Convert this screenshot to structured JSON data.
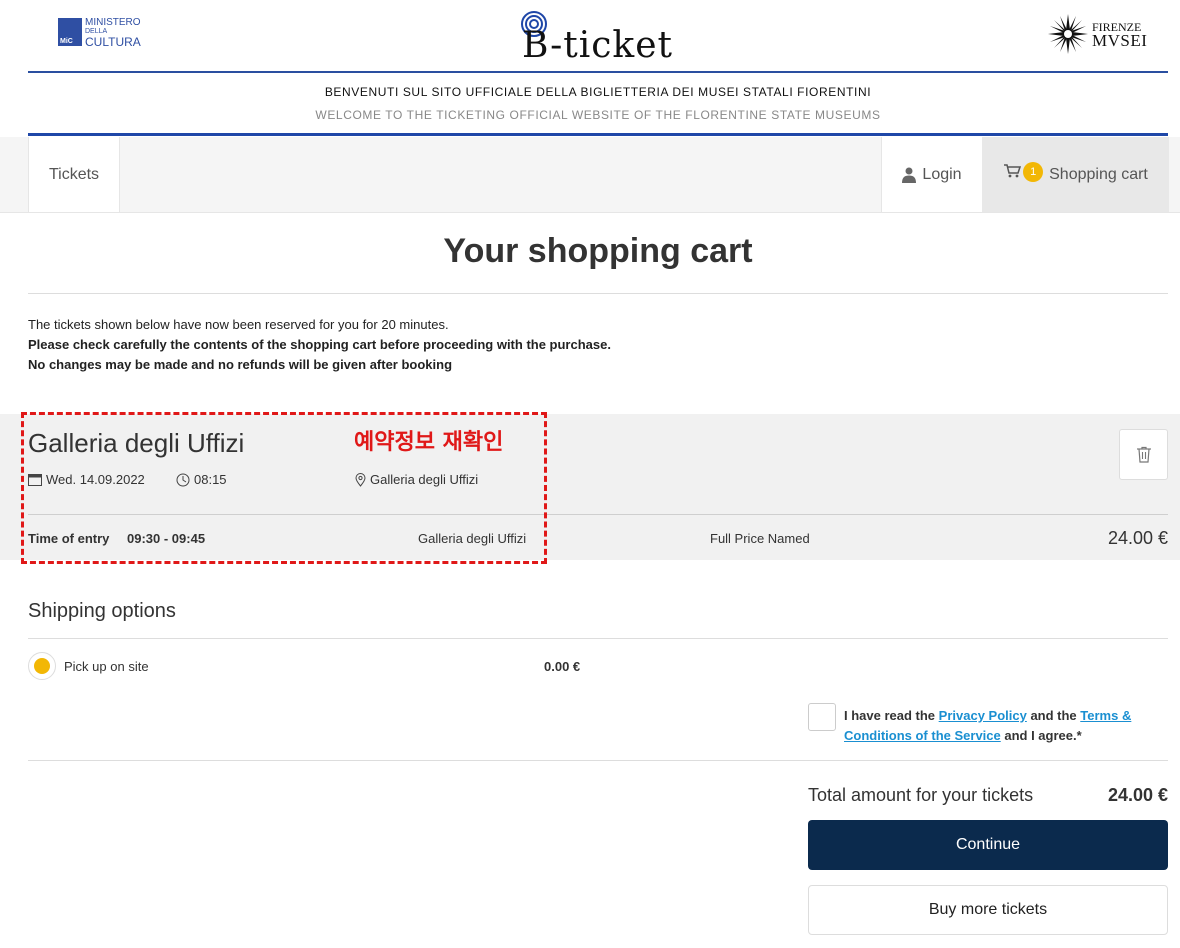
{
  "header": {
    "mic_logo": {
      "line1": "MINISTERO",
      "line2": "DELLA",
      "line3": "CULTURA",
      "emblem": "MiC"
    },
    "brand": "B-ticket",
    "firenze_logo": {
      "line1": "FIRENZE",
      "line2": "MVSEI"
    },
    "welcome_it": "BENVENUTI SUL SITO UFFICIALE DELLA BIGLIETTERIA DEI MUSEI STATALI FIORENTINI",
    "welcome_en": "WELCOME TO THE TICKETING OFFICIAL WEBSITE OF THE FLORENTINE STATE MUSEUMS"
  },
  "nav": {
    "tickets": "Tickets",
    "login": "Login",
    "cart_label": "Shopping cart",
    "cart_count": "1"
  },
  "page": {
    "title": "Your shopping cart",
    "notice": [
      "The tickets shown below have now been reserved for you for 20 minutes.",
      "Please check carefully the contents of the shopping cart before proceeding with the purchase.",
      "No changes may be made and no refunds will be given after booking"
    ]
  },
  "cart_item": {
    "museum": "Galleria degli Uffizi",
    "date": "Wed. 14.09.2022",
    "time": "08:15",
    "location": "Galleria degli Uffizi",
    "entry_label": "Time of entry",
    "entry_slot": "09:30 - 09:45",
    "venue": "Galleria degli Uffizi",
    "ticket_type": "Full Price Named",
    "price": "24.00 €"
  },
  "annotation": {
    "label": "예약정보 재확인",
    "color": "#e01818"
  },
  "shipping": {
    "title": "Shipping options",
    "option_label": "Pick up on site",
    "option_price": "0.00 €"
  },
  "agreement": {
    "prefix": "I have read the ",
    "privacy_link": "Privacy Policy",
    "middle": " and the ",
    "terms_link": "Terms & Conditions of the Service",
    "suffix": " and I agree.*"
  },
  "totals": {
    "label": "Total amount for your tickets",
    "value": "24.00 €"
  },
  "buttons": {
    "continue": "Continue",
    "buy_more": "Buy more tickets"
  },
  "colors": {
    "brand_blue": "#1f47a8",
    "accent_yellow": "#f2b705",
    "continue_bg": "#0b2a4d",
    "link": "#1a8fd1"
  }
}
